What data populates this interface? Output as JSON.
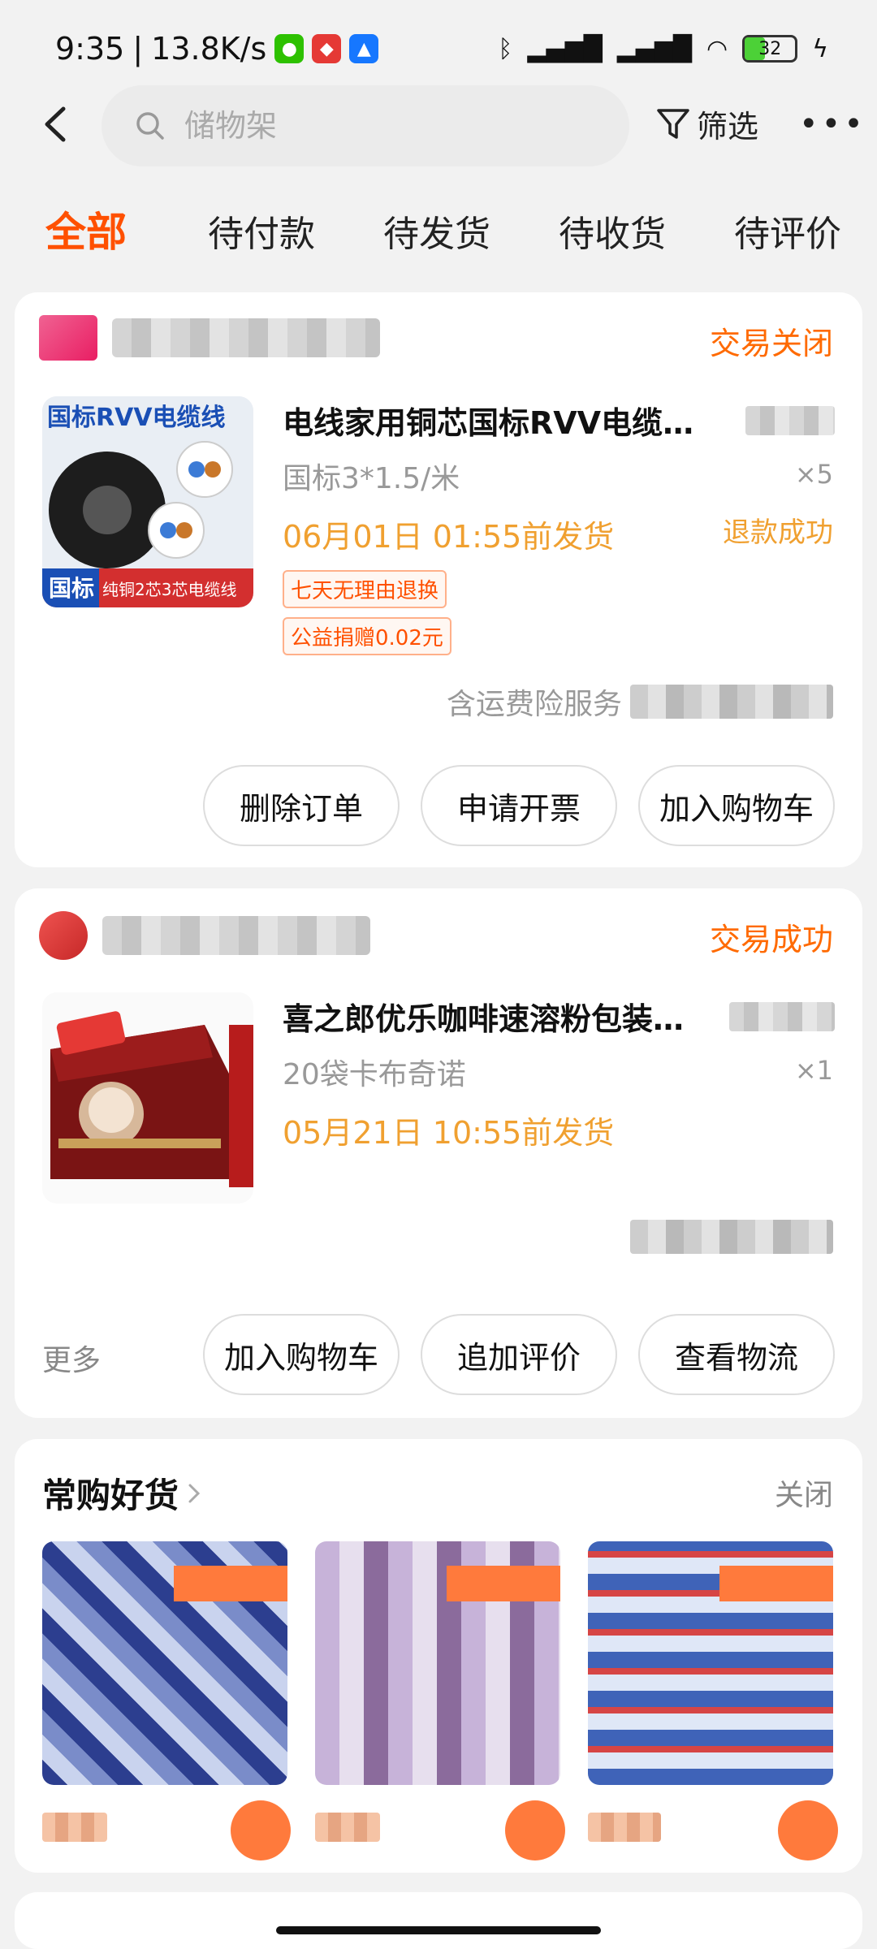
{
  "status_bar": {
    "time": "9:35",
    "speed": "13.8K/s",
    "battery": "32"
  },
  "search": {
    "placeholder": "储物架"
  },
  "header": {
    "filter_label": "筛选",
    "more_icon": "more-dots-icon"
  },
  "tabs": [
    {
      "label": "全部",
      "active": true
    },
    {
      "label": "待付款"
    },
    {
      "label": "待发货"
    },
    {
      "label": "待收货"
    },
    {
      "label": "待评价"
    }
  ],
  "orders": [
    {
      "status": "交易关闭",
      "title": "电线家用铜芯国标RVV电缆…",
      "sku": "国标3*1.5/米",
      "ship": "06月01日 01:55前发货",
      "qty": "×5",
      "refund": "退款成功",
      "tags": [
        "七天无理由退换",
        "公益捐赠0.02元"
      ],
      "insurance": "含运费险服务",
      "thumb_text": {
        "top": "国标RVV电缆线",
        "badge": "国标",
        "bottom": "纯铜2芯3芯电缆线"
      },
      "buttons": [
        "删除订单",
        "申请开票",
        "加入购物车"
      ]
    },
    {
      "status": "交易成功",
      "title": "喜之郎优乐咖啡速溶粉包装…",
      "sku": "20袋卡布奇诺",
      "ship": "05月21日 10:55前发货",
      "qty": "×1",
      "more": "更多",
      "buttons": [
        "加入购物车",
        "追加评价",
        "查看物流"
      ]
    }
  ],
  "recommend": {
    "title": "常购好货",
    "close": "关闭"
  },
  "colors": {
    "accent": "#ff5000",
    "ship": "#f0a030"
  }
}
